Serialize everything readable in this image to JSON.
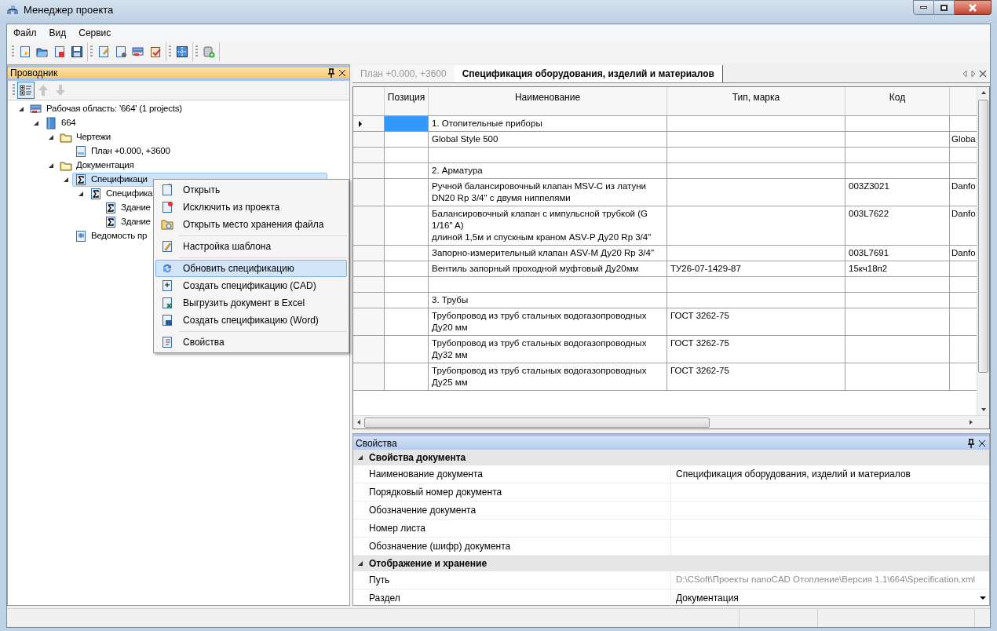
{
  "window": {
    "title": "Менеджер проекта"
  },
  "menu": [
    "Файл",
    "Вид",
    "Сервис"
  ],
  "explorer": {
    "title": "Проводник",
    "toolbar": [
      {
        "kind": "tree-view",
        "pressed": true,
        "disabled": false
      },
      {
        "kind": "up",
        "pressed": false,
        "disabled": true
      },
      {
        "kind": "down",
        "pressed": false,
        "disabled": true
      }
    ],
    "tree": [
      {
        "label": "Рабочая область: '664' (1 projects)",
        "kind": "workspace",
        "expanded": true,
        "selected": false,
        "children": [
          {
            "label": "664",
            "kind": "project",
            "expanded": true,
            "selected": false,
            "children": [
              {
                "label": "Чертежи",
                "kind": "folder",
                "expanded": true,
                "selected": false,
                "children": [
                  {
                    "label": "План +0.000, +3600",
                    "kind": "drawing",
                    "selected": false
                  }
                ]
              },
              {
                "label": "Документация",
                "kind": "folder",
                "expanded": true,
                "selected": false,
                "children": [
                  {
                    "label": "Спецификаци",
                    "kind": "spec",
                    "expanded": true,
                    "selected": true,
                    "children": [
                      {
                        "label": "Специфика",
                        "kind": "spec",
                        "expanded": true,
                        "selected": false,
                        "children": [
                          {
                            "label": "Здание",
                            "kind": "spec",
                            "selected": false
                          },
                          {
                            "label": "Здание",
                            "kind": "spec",
                            "selected": false
                          }
                        ]
                      }
                    ]
                  },
                  {
                    "label": "Ведомость пр",
                    "kind": "statement",
                    "selected": false
                  }
                ]
              }
            ]
          }
        ]
      }
    ]
  },
  "context_menu": [
    {
      "kind": "item",
      "label": "Открыть",
      "selected": false
    },
    {
      "kind": "item",
      "label": "Исключить из проекта",
      "selected": false
    },
    {
      "kind": "item",
      "label": "Открыть место хранения файла",
      "selected": false
    },
    {
      "kind": "separator"
    },
    {
      "kind": "item",
      "label": "Настройка шаблона",
      "selected": false
    },
    {
      "kind": "separator"
    },
    {
      "kind": "item",
      "label": "Обновить спецификацию",
      "selected": true
    },
    {
      "kind": "item",
      "label": "Создать спецификацию (CAD)",
      "selected": false
    },
    {
      "kind": "item",
      "label": "Выгрузить документ в Excel",
      "selected": false
    },
    {
      "kind": "item",
      "label": "Создать спецификацию (Word)",
      "selected": false
    },
    {
      "kind": "separator"
    },
    {
      "kind": "item",
      "label": "Свойства",
      "selected": false
    }
  ],
  "tabs": [
    {
      "label": "План +0.000, +3600",
      "selected": false
    },
    {
      "label": "Спецификация оборудования, изделий и материалов",
      "selected": true
    }
  ],
  "table": {
    "columns": [
      "Позиция",
      "Наименование",
      "Тип, марка",
      "Код"
    ],
    "rows": [
      {
        "selected": true,
        "name": "1. Отопительные приборы"
      },
      {
        "selected": false,
        "name": "Global Style 500",
        "column_5": "Globa"
      },
      {
        "selected": false
      },
      {
        "selected": false,
        "name": "2. Арматура"
      },
      {
        "selected": false,
        "name": "Ручной балансировочный клапан MSV-C из латуни\nDN20 Rp 3/4\" с двумя ниппелями",
        "code": "003Z3021",
        "column_5": "Danfo"
      },
      {
        "selected": false,
        "name": "Балансировочный клапан с импульсной трубкой (G\n1/16\" A)\nдлиной 1,5м и спускным краном ASV-P Ду20 Rp 3/4\"",
        "code": "003L7622",
        "column_5": "Danfo"
      },
      {
        "selected": false,
        "name": "Запорно-измерительный клапан ASV-M Ду20 Rp 3/4\"",
        "code": "003L7691",
        "column_5": "Danfo"
      },
      {
        "selected": false,
        "name": "Вентиль запорный проходной муфтовый Ду20мм",
        "type": "ТУ26-07-1429-87",
        "code": "15кч18п2"
      },
      {
        "selected": false
      },
      {
        "selected": false,
        "name": "3. Трубы"
      },
      {
        "selected": false,
        "name": "Трубопровод из труб стальных водогазопроводных\nДу20 мм",
        "type": "ГОСТ 3262-75"
      },
      {
        "selected": false,
        "name": "Трубопровод из труб стальных водогазопроводных\nДу32 мм",
        "type": "ГОСТ 3262-75"
      },
      {
        "selected": false,
        "name": "Трубопровод из труб стальных водогазопроводных\nДу25 мм",
        "type": "ГОСТ 3262-75"
      }
    ]
  },
  "properties": {
    "title": "Свойства",
    "categories": [
      {
        "title": "Свойства документа",
        "expanded": true,
        "rows": [
          {
            "name": "Наименование документа",
            "value": "Спецификация оборудования, изделий и материалов",
            "kind": "text"
          },
          {
            "name": "Порядковый номер документа",
            "kind": "text"
          },
          {
            "name": "Обозначение документа",
            "kind": "text"
          },
          {
            "name": "Номер листа",
            "kind": "text"
          },
          {
            "name": "Обозначение (шифр) документа",
            "kind": "text"
          }
        ]
      },
      {
        "title": "Отображение и хранение",
        "expanded": true,
        "rows": [
          {
            "name": "Путь",
            "value": "D:\\CSoft\\Проекты nanoCAD Отопление\\Версия 1.1\\664\\Specification.xml",
            "kind": "text",
            "disabled": true
          },
          {
            "name": "Раздел",
            "value": "Документация",
            "kind": "dropdown"
          }
        ]
      }
    ]
  }
}
